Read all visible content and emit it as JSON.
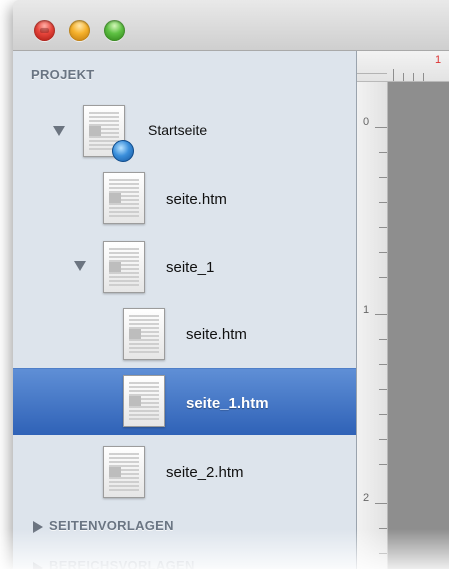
{
  "sidebar": {
    "project_header": "PROJEKT",
    "tree": [
      {
        "label": "Startseite",
        "expanded": true,
        "icon": "globe-page-icon"
      },
      {
        "label": "seite.htm",
        "icon": "document-icon"
      },
      {
        "label": "seite_1",
        "expanded": true,
        "icon": "document-icon"
      },
      {
        "label": "seite.htm",
        "icon": "document-icon"
      },
      {
        "label": "seite_1.htm",
        "selected": true,
        "icon": "document-icon"
      },
      {
        "label": "seite_2.htm",
        "icon": "document-icon"
      }
    ],
    "templates_header": "SEITENVORLAGEN",
    "partial_header": "BEREICHSVORLAGEN"
  },
  "ruler": {
    "top_marker": "1",
    "labels": [
      "0",
      "1",
      "2"
    ]
  },
  "colors": {
    "selection": "#2f62b7",
    "sidebar_bg": "#dde4ec",
    "header_text": "#6a7583"
  }
}
